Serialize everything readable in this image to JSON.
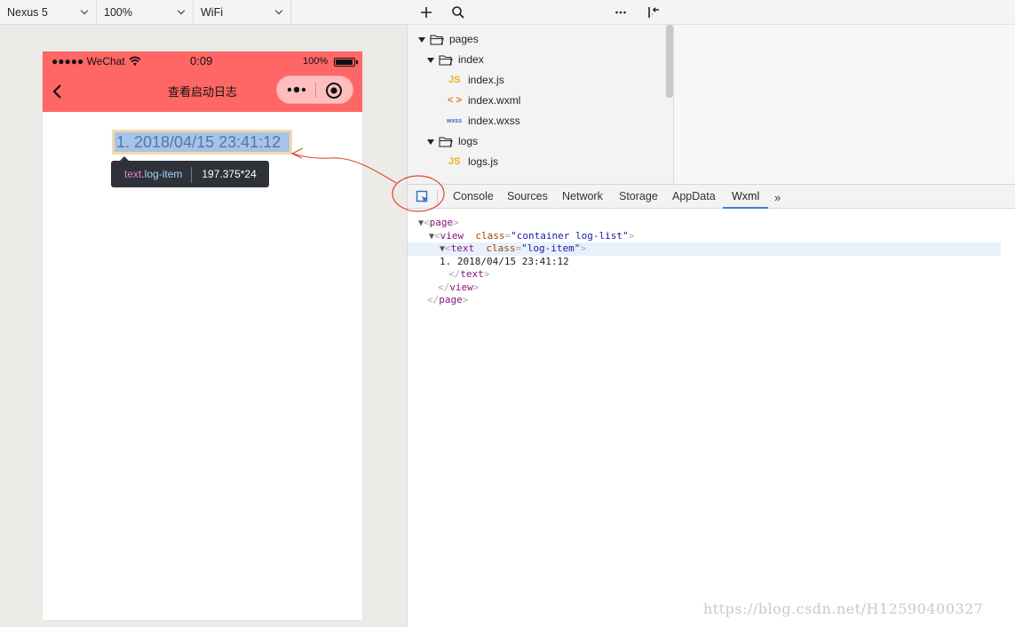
{
  "simulator": {
    "device": "Nexus 5",
    "zoom": "100%",
    "network": "WiFi",
    "status_bar": {
      "carrier": "●●●●● WeChat",
      "time": "0:09",
      "battery": "100%"
    },
    "nav_title": "查看启动日志",
    "log_items": [
      "1. 2018/04/15 23:41:12"
    ],
    "tooltip": {
      "tag": "text",
      "class": ".log-item",
      "size": "197.375*24"
    }
  },
  "file_tree": [
    {
      "label": "pages",
      "type": "folder",
      "depth": 0
    },
    {
      "label": "index",
      "type": "folder",
      "depth": 1
    },
    {
      "label": "index.js",
      "type": "file",
      "icon": "JS",
      "depth": 2
    },
    {
      "label": "index.wxml",
      "type": "file",
      "icon": "< >",
      "depth": 2
    },
    {
      "label": "index.wxss",
      "type": "file",
      "icon": "wxss",
      "depth": 2
    },
    {
      "label": "logs",
      "type": "folder",
      "depth": 1
    },
    {
      "label": "logs.js",
      "type": "file",
      "icon": "JS",
      "depth": 2
    }
  ],
  "devtools": {
    "tabs": [
      "Console",
      "Sources",
      "Network",
      "Storage",
      "AppData",
      "Wxml"
    ],
    "active_tab": "Wxml",
    "more": "»"
  },
  "wxml": {
    "page_open": "page",
    "view_open": {
      "tag": "view",
      "attr": "class",
      "value": "container log-list"
    },
    "text_open": {
      "tag": "text",
      "attr": "class",
      "value": "log-item"
    },
    "text_content": "1. 2018/04/15 23:41:12",
    "text_close": "text",
    "view_close": "view",
    "page_close": "page"
  },
  "watermark": "https://blog.csdn.net/H12590400327",
  "colors": {
    "nav_bar": "#ff6666",
    "highlight_fill": "#a5c4e6",
    "highlight_border": "#f2d8ad",
    "annotation": "#e0442e",
    "active_tab_underline": "#3b82d6"
  }
}
